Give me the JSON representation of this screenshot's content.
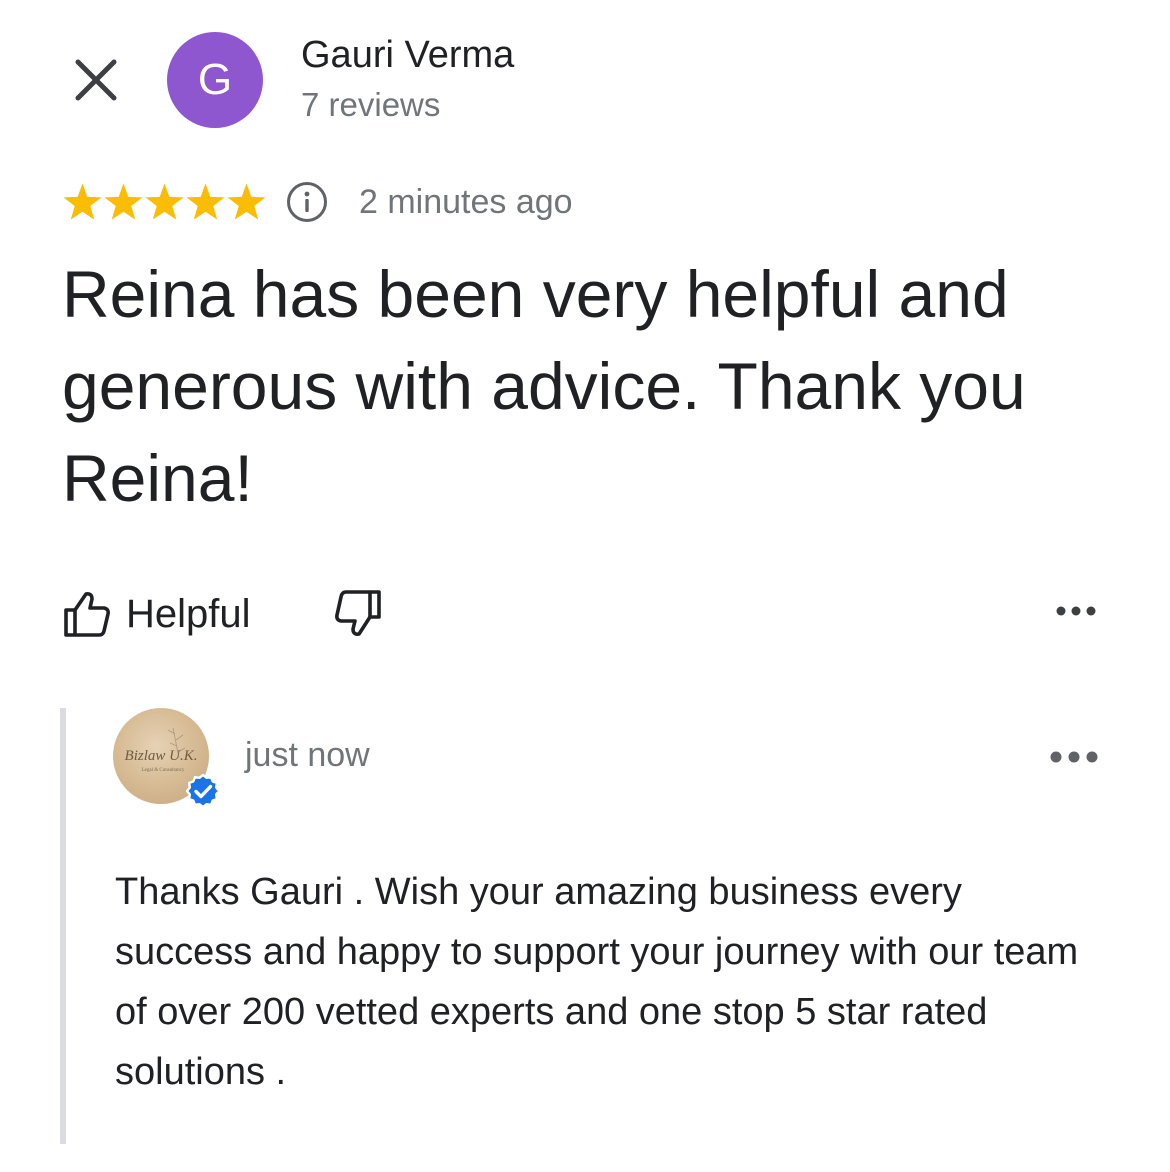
{
  "close": {
    "icon": "close-icon"
  },
  "reviewer": {
    "initial": "G",
    "avatar_color": "#8e56cf",
    "name": "Gauri Verma",
    "reviews": "7 reviews"
  },
  "rating": {
    "stars": 5,
    "max_stars": 5,
    "star_color": "#fbbc04",
    "info_icon": "info-icon",
    "time": "2 minutes ago"
  },
  "review": {
    "text": "Reina has been very helpful and generous with advice. Thank you Reina!"
  },
  "actions": {
    "helpful_label": "Helpful",
    "helpful_icon": "thumb-up-icon",
    "not_helpful_icon": "thumb-down-icon",
    "more_icon": "more-options-icon"
  },
  "owner_reply": {
    "logo_text": "Bizlaw U.K.",
    "logo_subtext": "Legal & Consultancy",
    "verified_color": "#1a73e8",
    "time": "just now",
    "more_icon": "more-options-icon",
    "text": "Thanks Gauri . Wish your amazing business every success and happy to support your journey with our team of over 200 vetted experts and one stop 5 star rated solutions ."
  }
}
